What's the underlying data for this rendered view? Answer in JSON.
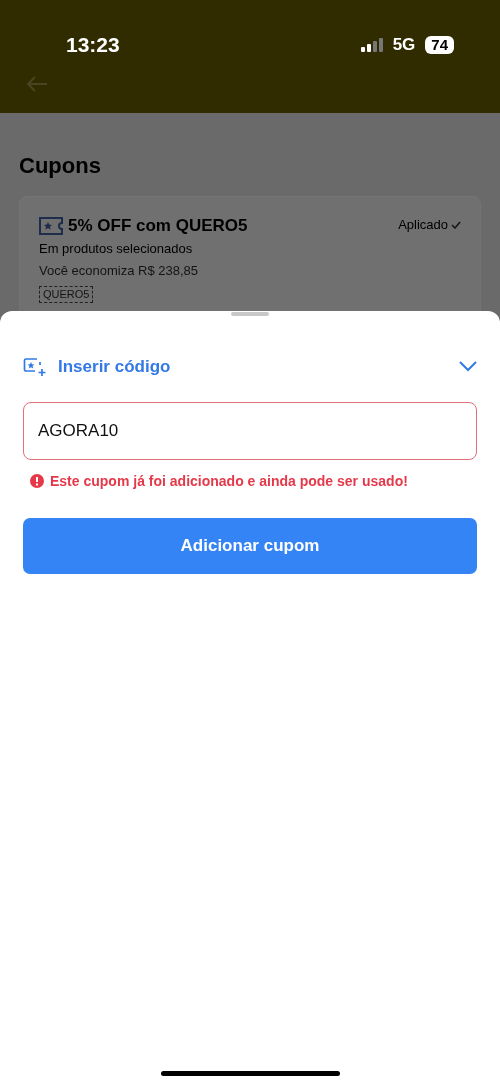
{
  "status_bar": {
    "time": "13:23",
    "network": "5G",
    "battery": "74"
  },
  "page": {
    "title": "Cupons"
  },
  "coupons": [
    {
      "title": "5% OFF com QUERO5",
      "subtitle": "Em produtos selecionados",
      "savings": "Você economiza R$ 238,85",
      "code": "QUERO5",
      "status": "Aplicado",
      "applied": true
    }
  ],
  "sheet": {
    "toggle_label": "Inserir código",
    "expanded": true,
    "field_value": "AGORA10",
    "error": "Este cupom já foi adicionado e ainda pode ser usado!",
    "button": "Adicionar cupom"
  }
}
